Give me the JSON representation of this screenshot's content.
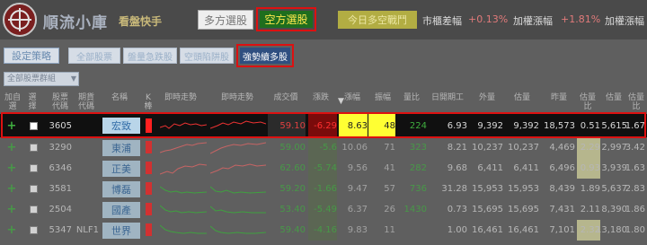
{
  "header": {
    "brand_main": "順流小庫",
    "brand_sub": "看盤快手",
    "mode_long": "多方選股",
    "mode_short": "空方選股",
    "ratio_label": "今日多空戰鬥",
    "market_label": "市櫃差幅",
    "market_value": "+0.13%",
    "index_label": "加權漲幅",
    "index_value": "+1.81%",
    "extra_label": "加權漲幅"
  },
  "toolbar": {
    "strategy_button": "設定策略",
    "tabs": [
      "全部股票",
      "盤量急跌股",
      "空頭陷阱股",
      "強勢續多股"
    ],
    "active_tab": "強勢續多股",
    "select_value": "全部股票群組"
  },
  "table": {
    "headers": [
      "加自選",
      "選\n擇",
      "股票\n代碼",
      "期貨\n代碼",
      "名稱",
      "K\n棒",
      "即時走勢",
      "即時走勢",
      "成交價",
      "漲跌",
      "漲幅",
      "振幅",
      "量比",
      "日開期工",
      "外量",
      "估量",
      "昨量",
      "估量\n比",
      "估量",
      "估量\n比"
    ],
    "rows": [
      {
        "code": "3605",
        "fut": "",
        "name": "宏致",
        "price": "59.10",
        "chg": "-6.29",
        "pct": "8.63",
        "amp": "48",
        "ratio": "224",
        "c1": "6.93",
        "c2": "9,392",
        "c3": "9,392",
        "c4": "18,573",
        "c5": "0.51",
        "c6": "5,615",
        "c7": "1.67"
      },
      {
        "code": "3290",
        "fut": "",
        "name": "東浦",
        "price": "59.00",
        "chg": "-5.6",
        "pct": "10.06",
        "amp": "71",
        "ratio": "323",
        "c1": "8.21",
        "c2": "10,237",
        "c3": "10,237",
        "c4": "4,469",
        "c5": "2.29",
        "c6": "2,997",
        "c7": "3.42"
      },
      {
        "code": "6346",
        "fut": "",
        "name": "正美",
        "price": "62.60",
        "chg": "-5.74",
        "pct": "9.56",
        "amp": "41",
        "ratio": "282",
        "c1": "9.68",
        "c2": "6,411",
        "c3": "6,411",
        "c4": "6,496",
        "c5": "0.93",
        "c6": "3,939",
        "c7": "1.63"
      },
      {
        "code": "3581",
        "fut": "",
        "name": "博磊",
        "price": "59.20",
        "chg": "-1.66",
        "pct": "9.47",
        "amp": "57",
        "ratio": "736",
        "c1": "31.28",
        "c2": "15,953",
        "c3": "15,953",
        "c4": "8,439",
        "c5": "1.89",
        "c6": "5,637",
        "c7": "2.83"
      },
      {
        "code": "2504",
        "fut": "",
        "name": "國產",
        "price": "53.40",
        "chg": "-5.49",
        "pct": "6.37",
        "amp": "26",
        "ratio": "1430",
        "c1": "0.73",
        "c2": "15,695",
        "c3": "15,695",
        "c4": "7,431",
        "c5": "2.11",
        "c6": "8,390",
        "c7": "1.86"
      },
      {
        "code": "5347",
        "fut": "NLF1",
        "name": "世界",
        "price": "59.40",
        "chg": "-4.16",
        "pct": "9.83",
        "amp": "11",
        "ratio": "",
        "c1": "1.00",
        "c2": "16,461",
        "c3": "16,461",
        "c4": "7,101",
        "c5": "2.32",
        "c6": "13,180",
        "c7": "1.80"
      }
    ]
  },
  "colors": {
    "selected_border": "#dd1111",
    "active_mode_bg": "#1e6e1e",
    "active_mode_text": "#ffe94d",
    "up": "#e05050",
    "down": "#3fae3f",
    "highlight": "#ffff33"
  }
}
